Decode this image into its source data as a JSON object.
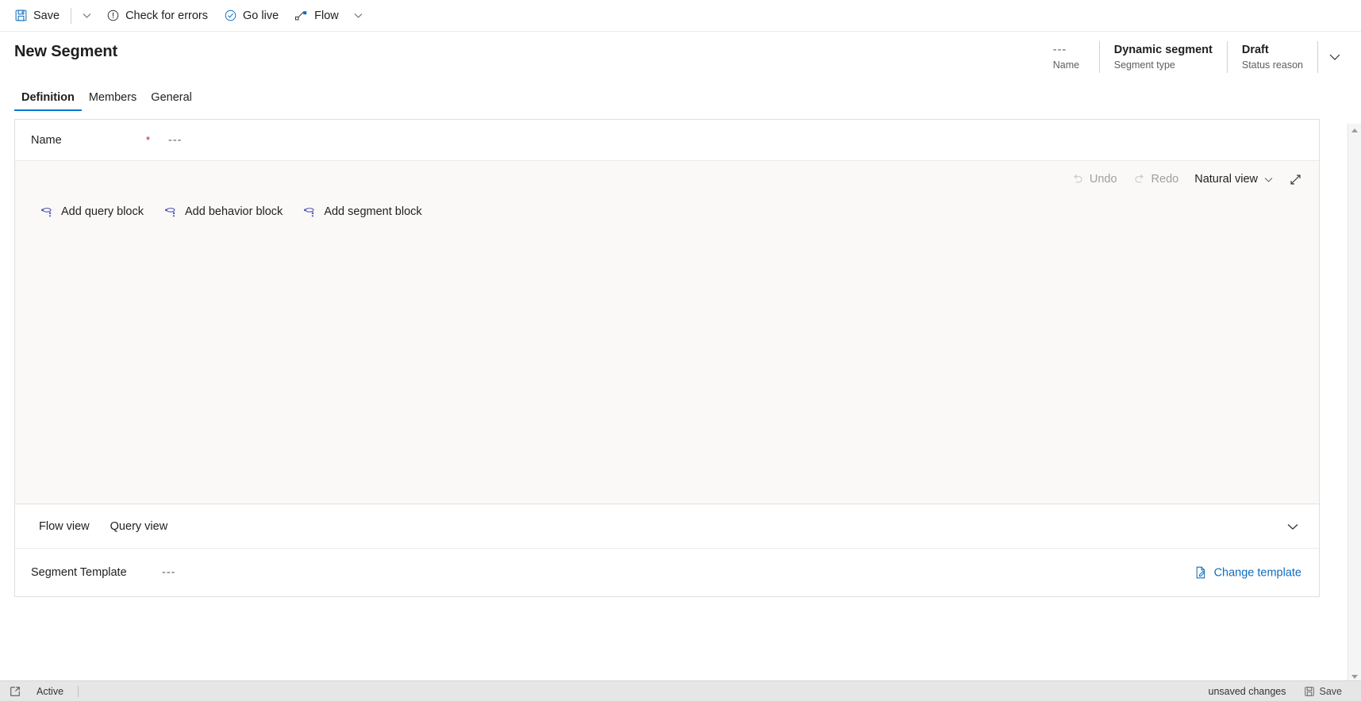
{
  "commandbar": {
    "items": [
      {
        "label": "Save",
        "icon": "save-icon"
      },
      {
        "label": "Check for errors",
        "icon": "error-circle-icon"
      },
      {
        "label": "Go live",
        "icon": "check-circle-icon"
      },
      {
        "label": "Flow",
        "icon": "flow-icon"
      }
    ],
    "save_caret": "chevron-down-icon",
    "flow_caret": "chevron-down-icon"
  },
  "header": {
    "title": "New Segment",
    "fields": [
      {
        "value": "---",
        "label": "Name"
      },
      {
        "value": "Dynamic segment",
        "label": "Segment type"
      },
      {
        "value": "Draft",
        "label": "Status reason"
      }
    ],
    "collapse_icon": "chevron-down-icon"
  },
  "tabs": [
    {
      "label": "Definition",
      "active": true
    },
    {
      "label": "Members",
      "active": false
    },
    {
      "label": "General",
      "active": false
    }
  ],
  "form": {
    "name_label": "Name",
    "name_required_mark": "*",
    "name_value": "---"
  },
  "canvas": {
    "toolbar": {
      "undo": "Undo",
      "redo": "Redo",
      "view_mode": "Natural view",
      "view_caret": "chevron-down-icon",
      "expand_icon": "expand-diagonal-icon"
    },
    "blocks": [
      {
        "label": "Add query block",
        "icon": "add-query-block-icon"
      },
      {
        "label": "Add behavior block",
        "icon": "add-behavior-block-icon"
      },
      {
        "label": "Add segment block",
        "icon": "add-segment-block-icon"
      }
    ]
  },
  "views": {
    "tabs": [
      {
        "label": "Flow view"
      },
      {
        "label": "Query view"
      }
    ],
    "collapse_icon": "chevron-down-icon"
  },
  "template": {
    "label": "Segment Template",
    "value": "---",
    "change_label": "Change template",
    "change_icon": "edit-page-icon"
  },
  "statusbar": {
    "popout_icon": "open-in-new-icon",
    "state": "Active",
    "unsaved": "unsaved changes",
    "save_label": "Save",
    "save_icon": "save-icon"
  },
  "colors": {
    "accent": "#0078d4",
    "link": "#0f6cbd",
    "required": "#a4262c",
    "block_icon": "#4f52b2",
    "canvas_bg": "#faf9f8",
    "statusbar_bg": "#e6e6e6"
  }
}
